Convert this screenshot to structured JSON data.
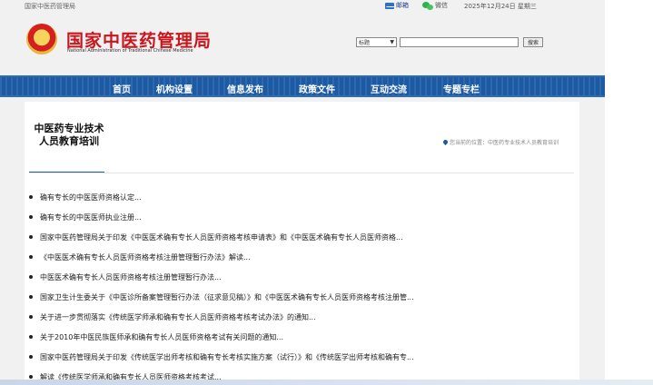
{
  "topbar": {
    "site_name": "国家中医药管理局",
    "mail_label": "邮箱",
    "wechat_label": "微信",
    "date": "2025年12月24日 星期三"
  },
  "header": {
    "logo_cn": "国家中医药管理局",
    "logo_en": "National Administration of Traditional Chinese Medicine",
    "search": {
      "selected_option": "标题",
      "input_value": "",
      "button_label": "搜索"
    }
  },
  "nav": {
    "items": [
      "首页",
      "机构设置",
      "信息发布",
      "政策文件",
      "互动交流",
      "专题专栏"
    ]
  },
  "main": {
    "section_title": "中医药专业技术人员教育培训",
    "breadcrumb": "您当前的位置：中医药专业技术人员教育培训",
    "items": [
      "确有专长的中医医师资格认定...",
      "确有专长的中医医师执业注册...",
      "国家中医药管理局关于印发《中医医术确有专长人员医师资格考核申请表》和《中医医术确有专长人员医师资格...",
      "《中医医术确有专长人员医师资格考核注册管理暂行办法》解读...",
      "中医医术确有专长人员医师资格考核注册管理暂行办法...",
      "国家卫生计生委关于《中医诊所备案管理暂行办法（征求意见稿）》和《中医医术确有专长人员医师资格考核注册管...",
      "关于进一步贯彻落实《传统医学师承和确有专长人员医师资格考核考试办法》的通知...",
      "关于2010年中医民族医师承和确有专长人员医师资格考试有关问题的通知...",
      "国家中医药管理局关于印发《传统医学出师考核和确有专长考核实施方案（试行）》和《传统医学出师考核和确有专...",
      "解读《传统医学师承和确有专长人员医师资格考核考试..."
    ]
  },
  "colors": {
    "brand_red": "#c9161d",
    "nav_blue": "#1c5aa3"
  }
}
